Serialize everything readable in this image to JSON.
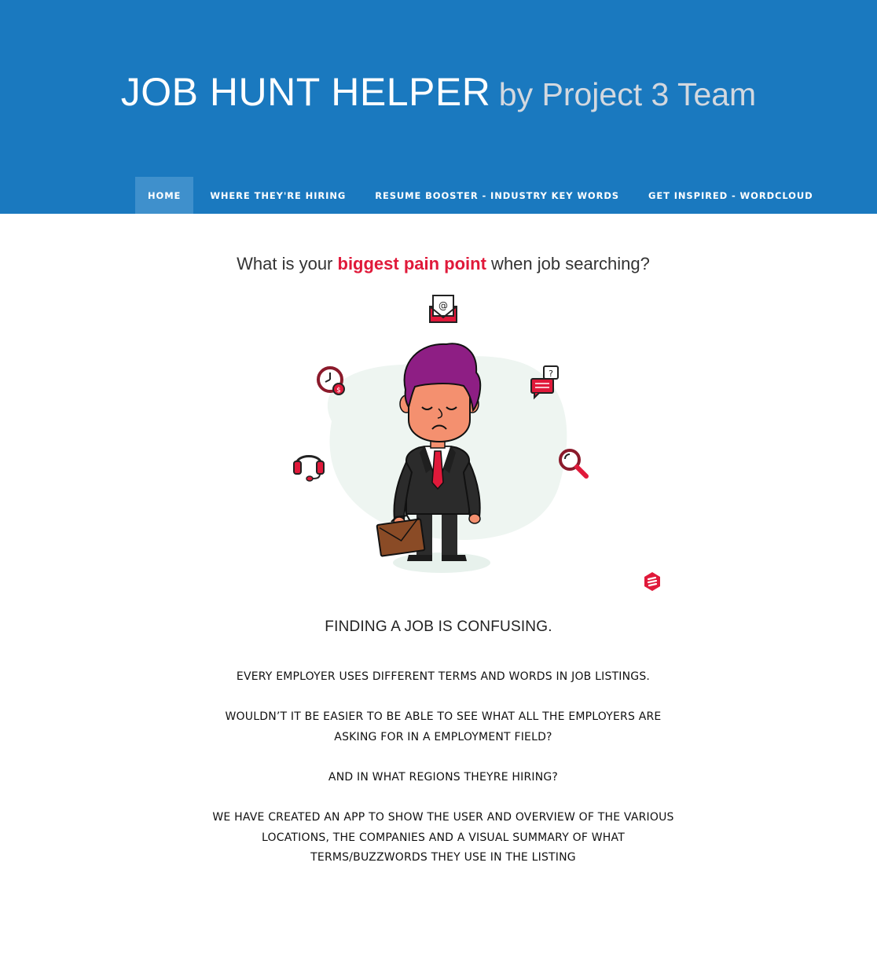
{
  "site": {
    "title": "JOB HUNT HELPER",
    "subtitle": "by Project 3 Team",
    "header_color": "#1a79bf"
  },
  "nav": {
    "items": [
      {
        "label": "HOME",
        "active": true
      },
      {
        "label": "WHERE THEY'RE HIRING",
        "active": false
      },
      {
        "label": "RESUME BOOSTER - INDUSTRY KEY WORDS",
        "active": false
      },
      {
        "label": "GET INSPIRED - WORDCLOUD",
        "active": false
      }
    ]
  },
  "hero": {
    "question_prefix": "What is your ",
    "question_highlight": "biggest pain point",
    "question_suffix": " when job searching?",
    "highlight_color": "#e0193a",
    "icons": [
      "email-icon",
      "clock-money-icon",
      "chat-question-icon",
      "headset-icon",
      "magnifier-icon",
      "brand-logo-icon"
    ]
  },
  "content": {
    "heading": "FINDING A JOB IS CONFUSING.",
    "paragraphs": [
      "EVERY EMPLOYER USES DIFFERENT TERMS AND WORDS IN JOB LISTINGS.",
      "WOULDN’T IT BE EASIER TO BE ABLE TO SEE WHAT ALL THE EMPLOYERS ARE ASKING FOR IN A EMPLOYMENT FIELD?",
      "AND IN WHAT REGIONS THEYRE HIRING?",
      "WE HAVE CREATED AN APP TO SHOW THE USER AND OVERVIEW OF THE VARIOUS LOCATIONS, THE COMPANIES AND A VISUAL SUMMARY OF WHAT TERMS/BUZZWORDS THEY USE IN THE LISTING"
    ]
  }
}
